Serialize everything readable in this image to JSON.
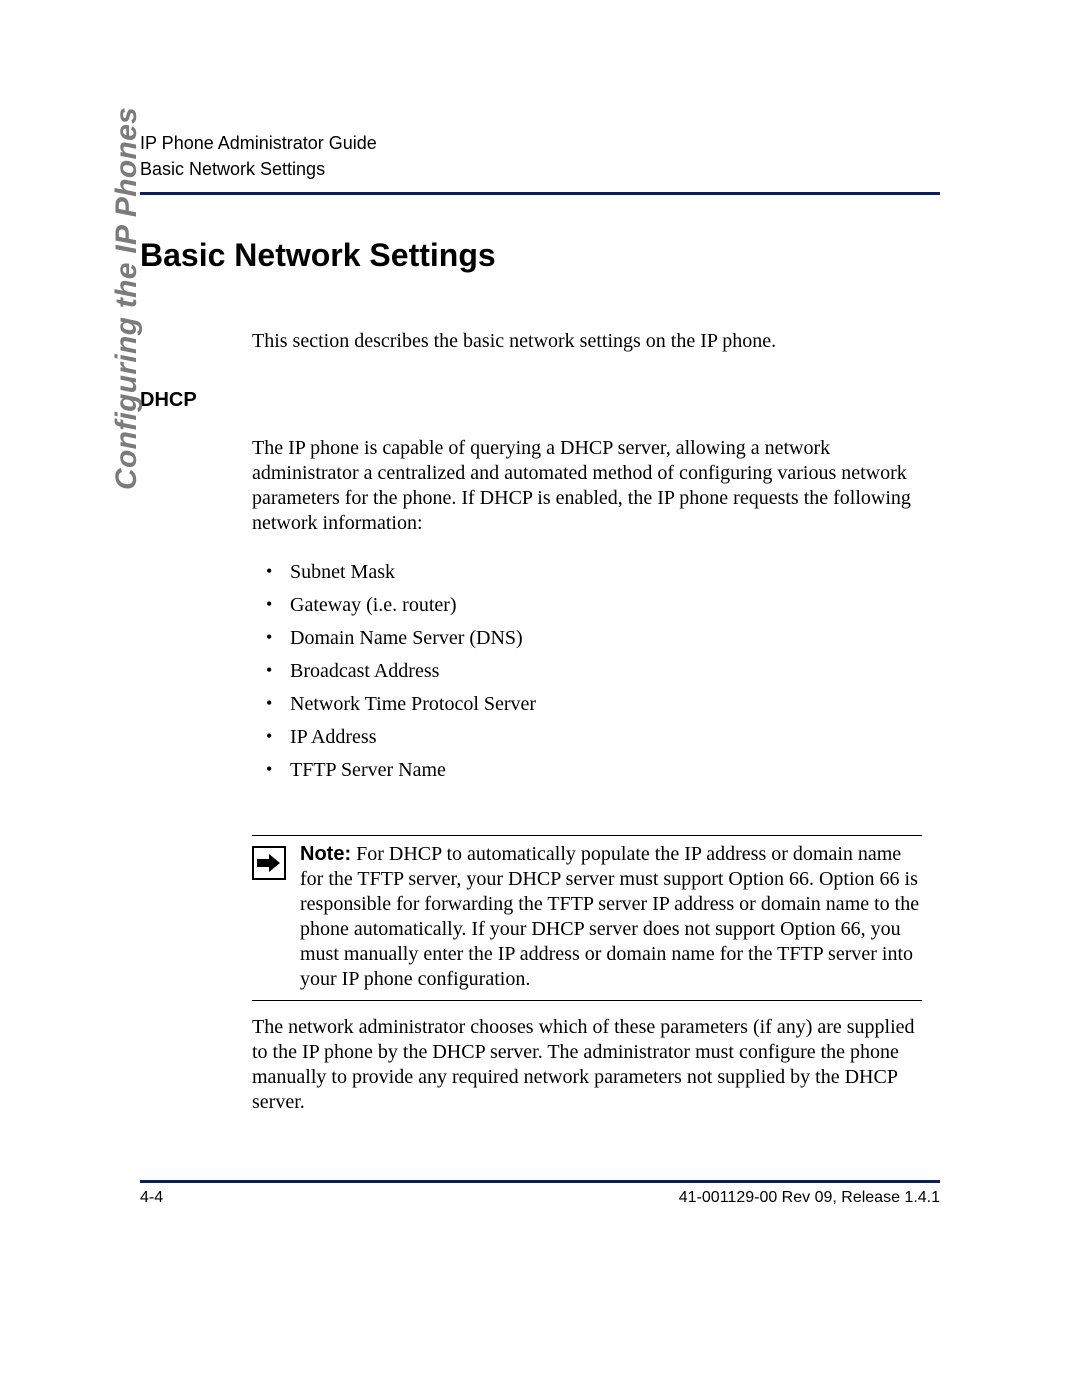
{
  "header": {
    "line1": "IP Phone Administrator Guide",
    "line2": "Basic Network Settings"
  },
  "sideTab": "Configuring the IP Phones",
  "section": {
    "title": "Basic Network Settings",
    "intro": "This section describes the basic network settings on the IP phone.",
    "dhcp": {
      "heading": "DHCP",
      "para1": "The IP phone is capable of querying a DHCP server, allowing a network administrator a centralized and automated method of configuring various network parameters for the phone. If DHCP is enabled, the IP phone requests the following network information:",
      "bullets": [
        "Subnet Mask",
        "Gateway (i.e. router)",
        "Domain Name Server (DNS)",
        "Broadcast Address",
        "Network Time Protocol Server",
        "IP Address",
        "TFTP Server Name"
      ],
      "noteLabel": "Note:",
      "noteBody": " For DHCP to automatically populate the IP address or domain name for the TFTP server, your DHCP server must support Option 66. Option 66 is responsible for forwarding the TFTP server IP address or domain name to the phone automatically. If your DHCP server does not support Option 66, you must manually enter the IP address or domain name for the TFTP server into your IP phone configuration.",
      "para2": "The network administrator chooses which of these parameters (if any) are supplied to the IP phone by the DHCP server. The administrator must configure the phone manually to provide any required network parameters not supplied by the DHCP server."
    }
  },
  "footer": {
    "pageNum": "4-4",
    "docRef": "41-001129-00 Rev 09, Release 1.4.1"
  }
}
